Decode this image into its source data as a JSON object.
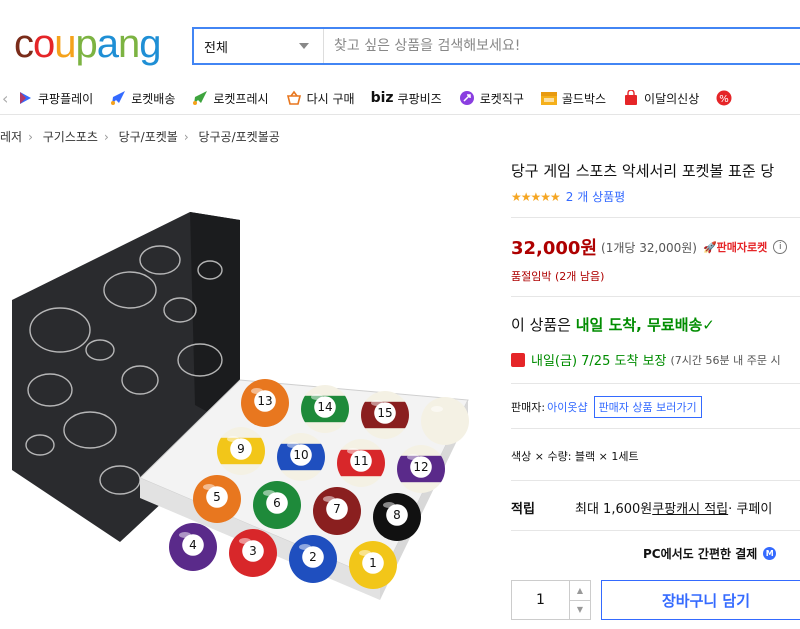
{
  "header": {
    "logo_letters": [
      {
        "ch": "c",
        "color": "#7a2c1a"
      },
      {
        "ch": "o",
        "color": "#e52528"
      },
      {
        "ch": "u",
        "color": "#f5a21b"
      },
      {
        "ch": "p",
        "color": "#7cb342"
      },
      {
        "ch": "a",
        "color": "#1f8fd5"
      },
      {
        "ch": "n",
        "color": "#7cb342"
      },
      {
        "ch": "g",
        "color": "#1f8fd5"
      }
    ],
    "logo_text": "coupang",
    "search_category": "전체",
    "search_placeholder": "찾고 싶은 상품을 검색해보세요!"
  },
  "nav": {
    "items": [
      {
        "label": "쿠팡플레이",
        "icon": "coupang-play-icon"
      },
      {
        "label": "로켓배송",
        "icon": "rocket-icon"
      },
      {
        "label": "로켓프레시",
        "icon": "rocket-fresh-icon"
      },
      {
        "label": "다시 구매",
        "icon": "basket-icon"
      },
      {
        "label": "쿠팡비즈",
        "prefix": "biz",
        "icon": "biz-icon"
      },
      {
        "label": "로켓직구",
        "icon": "rocket-direct-icon"
      },
      {
        "label": "골드박스",
        "icon": "gold-box-icon"
      },
      {
        "label": "이달의신상",
        "icon": "new-bag-icon"
      }
    ]
  },
  "breadcrumb": [
    "레저",
    "구기스포츠",
    "당구/포켓볼",
    "당구공/포켓볼공"
  ],
  "product": {
    "title": "당구 게임 스포츠 악세서리 포켓볼 표준 당",
    "stars": "★★★★★",
    "review_count": "2 개 상품평",
    "price": "32,000원",
    "unit_price": "(1개당 32,000원)",
    "seller_rocket": "🚀판매자로켓",
    "stock_notice": "품절임박 (2개 남음)",
    "delivery_prefix": "이 상품은 ",
    "delivery_highlight": "내일 도착, 무료배송",
    "arrival_date": "내일(금) 7/25 도착 보장",
    "arrival_note": "(7시간 56분 내 주문 시",
    "seller_label": "판매자:",
    "seller_name": "아이옷샵",
    "seller_button": "판매자 상품 보러가기",
    "option_text": "색상 × 수량: 블랙 × 1세트",
    "reward_label": "적립",
    "reward_prefix": "최대 1,600원 ",
    "reward_link": "쿠팡캐시 적립",
    "reward_suffix": " · 쿠페이",
    "pc_pay": "PC에서도 간편한 결제",
    "quantity": "1",
    "cart_button": "장바구니 담기"
  },
  "balls": [
    {
      "n": "13",
      "color": "#e8771f",
      "stripe": false
    },
    {
      "n": "14",
      "color": "#1e8a3a",
      "stripe": true
    },
    {
      "n": "15",
      "color": "#8a1f1f",
      "stripe": true
    },
    {
      "n": "",
      "color": "#f4f1e4",
      "stripe": false
    },
    {
      "n": "9",
      "color": "#f2c619",
      "stripe": true
    },
    {
      "n": "10",
      "color": "#1f4fbf",
      "stripe": true
    },
    {
      "n": "11",
      "color": "#d8272a",
      "stripe": true
    },
    {
      "n": "12",
      "color": "#5a2a8a",
      "stripe": true
    },
    {
      "n": "5",
      "color": "#e8771f",
      "stripe": false
    },
    {
      "n": "6",
      "color": "#1e8a3a",
      "stripe": false
    },
    {
      "n": "7",
      "color": "#8a1f1f",
      "stripe": false
    },
    {
      "n": "8",
      "color": "#111111",
      "stripe": false
    },
    {
      "n": "4",
      "color": "#5a2a8a",
      "stripe": false
    },
    {
      "n": "3",
      "color": "#d8272a",
      "stripe": false
    },
    {
      "n": "2",
      "color": "#1f4fbf",
      "stripe": false
    },
    {
      "n": "1",
      "color": "#f2c619",
      "stripe": false
    }
  ]
}
